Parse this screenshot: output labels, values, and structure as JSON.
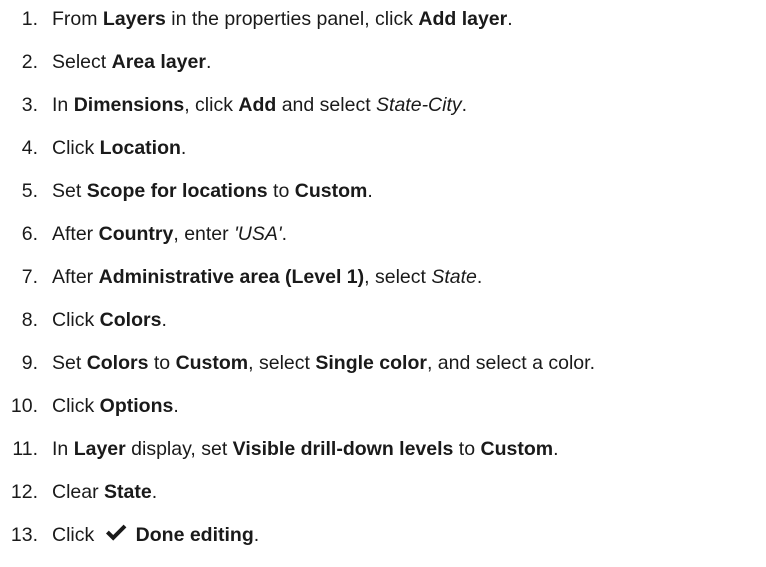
{
  "steps": [
    {
      "n": "1.",
      "parts": [
        {
          "t": "From "
        },
        {
          "t": "Layers",
          "b": true
        },
        {
          "t": " in the properties panel, click "
        },
        {
          "t": "Add layer",
          "b": true
        },
        {
          "t": "."
        }
      ]
    },
    {
      "n": "2.",
      "parts": [
        {
          "t": "Select "
        },
        {
          "t": "Area layer",
          "b": true
        },
        {
          "t": "."
        }
      ]
    },
    {
      "n": "3.",
      "parts": [
        {
          "t": "In "
        },
        {
          "t": "Dimensions",
          "b": true
        },
        {
          "t": ", click "
        },
        {
          "t": "Add",
          "b": true
        },
        {
          "t": " and select "
        },
        {
          "t": "State-City",
          "i": true
        },
        {
          "t": "."
        }
      ]
    },
    {
      "n": "4.",
      "parts": [
        {
          "t": "Click "
        },
        {
          "t": "Location",
          "b": true
        },
        {
          "t": "."
        }
      ]
    },
    {
      "n": "5.",
      "parts": [
        {
          "t": "Set "
        },
        {
          "t": "Scope for locations",
          "b": true
        },
        {
          "t": " to "
        },
        {
          "t": "Custom",
          "b": true
        },
        {
          "t": "."
        }
      ]
    },
    {
      "n": "6.",
      "parts": [
        {
          "t": "After "
        },
        {
          "t": "Country",
          "b": true
        },
        {
          "t": ", enter "
        },
        {
          "t": "'USA'",
          "i": true
        },
        {
          "t": "."
        }
      ]
    },
    {
      "n": "7.",
      "parts": [
        {
          "t": "After "
        },
        {
          "t": "Administrative area (Level 1)",
          "b": true
        },
        {
          "t": ", select "
        },
        {
          "t": "State",
          "i": true
        },
        {
          "t": "."
        }
      ]
    },
    {
      "n": "8.",
      "parts": [
        {
          "t": "Click "
        },
        {
          "t": "Colors",
          "b": true
        },
        {
          "t": "."
        }
      ]
    },
    {
      "n": "9.",
      "parts": [
        {
          "t": "Set "
        },
        {
          "t": "Colors",
          "b": true
        },
        {
          "t": " to "
        },
        {
          "t": "Custom",
          "b": true
        },
        {
          "t": ", select "
        },
        {
          "t": "Single color",
          "b": true
        },
        {
          "t": ", and select a color."
        }
      ]
    },
    {
      "n": "10.",
      "parts": [
        {
          "t": "Click "
        },
        {
          "t": "Options",
          "b": true
        },
        {
          "t": "."
        }
      ]
    },
    {
      "n": "11.",
      "parts": [
        {
          "t": "In "
        },
        {
          "t": "Layer",
          "b": true
        },
        {
          "t": " display, set "
        },
        {
          "t": "Visible drill-down levels",
          "b": true
        },
        {
          "t": " to "
        },
        {
          "t": "Custom",
          "b": true
        },
        {
          "t": "."
        }
      ]
    },
    {
      "n": "12.",
      "parts": [
        {
          "t": "Clear "
        },
        {
          "t": "State",
          "b": true
        },
        {
          "t": "."
        }
      ]
    },
    {
      "n": "13.",
      "parts": [
        {
          "t": "Click "
        },
        {
          "icon": "checkmark-icon"
        },
        {
          "t": "Done editing",
          "b": true
        },
        {
          "t": "."
        }
      ]
    }
  ],
  "colors": {
    "text": "#1a1a1a",
    "background": "#ffffff"
  }
}
